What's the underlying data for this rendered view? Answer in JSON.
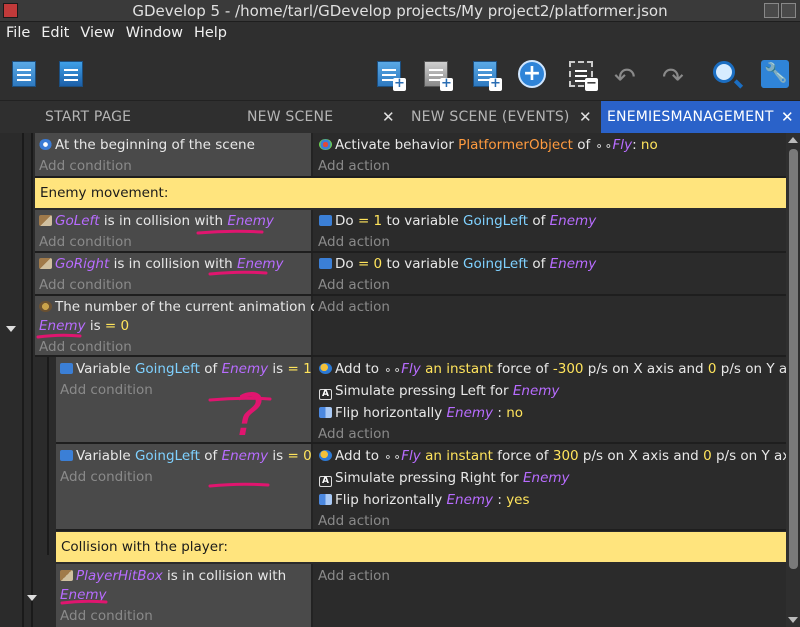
{
  "window": {
    "title": "GDevelop 5 - /home/tarl/GDevelop projects/My project2/platformer.json"
  },
  "menu": [
    "File",
    "Edit",
    "View",
    "Window",
    "Help"
  ],
  "toolbar": {
    "icons": [
      "project-manager-icon",
      "scene-icon",
      "add-event-icon",
      "add-subevent-icon",
      "add-event-alt-icon",
      "add-more-icon",
      "delete-event-icon",
      "undo-icon",
      "redo-icon",
      "search-icon",
      "settings-icon"
    ]
  },
  "tabs": [
    {
      "label": "START PAGE",
      "active": false
    },
    {
      "label": "NEW SCENE",
      "active": false
    },
    {
      "label": "NEW SCENE (EVENTS)",
      "active": false
    },
    {
      "label": "ENEMIESMANAGEMENT",
      "active": true
    }
  ],
  "close_glyph": "✕",
  "events": {
    "add_condition": "Add condition",
    "add_action": "Add action",
    "e1": {
      "cond": "At the beginning of the scene",
      "act_pre": "Activate behavior ",
      "act_beh": "PlatformerObject",
      "act_mid": " of ",
      "act_obj": "Fly",
      "act_post": ": ",
      "act_val": "no"
    },
    "comment1": "Enemy movement:",
    "e2": {
      "cond_obj": "GoLeft",
      "cond_mid": " is in collision with ",
      "cond_obj2": "Enemy",
      "act_pre": "Do ",
      "act_op": "= 1",
      "act_mid": " to variable ",
      "act_var": "GoingLeft",
      "act_of": " of ",
      "act_obj": "Enemy"
    },
    "e3": {
      "cond_obj": "GoRight",
      "cond_mid": " is in collision with ",
      "cond_obj2": "Enemy",
      "act_pre": "Do ",
      "act_op": "= 0",
      "act_mid": " to variable ",
      "act_var": "GoingLeft",
      "act_of": " of ",
      "act_obj": "Enemy"
    },
    "e4": {
      "cond_line1": "The number of the current animation of",
      "cond_obj": "Enemy",
      "cond_is": " is ",
      "cond_val": "= 0"
    },
    "e5": {
      "cond_pre": "Variable ",
      "cond_var": "GoingLeft",
      "cond_of": " of ",
      "cond_obj": "Enemy",
      "cond_is": " is ",
      "cond_val": "= 1",
      "a1_pre": "Add to ",
      "a1_obj": "Fly",
      "a1_kind": " an instant",
      "a1_mid": " force of ",
      "a1_x": "-300",
      "a1_mid2": " p/s on X axis and ",
      "a1_y": "0",
      "a1_post": " p/s on Y axis",
      "a2_pre": "Simulate pressing Left for ",
      "a2_obj": "Enemy",
      "a3_pre": "Flip horizontally ",
      "a3_obj": "Enemy",
      "a3_sep": " : ",
      "a3_val": "no"
    },
    "e6": {
      "cond_pre": "Variable ",
      "cond_var": "GoingLeft",
      "cond_of": " of ",
      "cond_obj": "Enemy",
      "cond_is": " is ",
      "cond_val": "= 0",
      "a1_pre": "Add to ",
      "a1_obj": "Fly",
      "a1_kind": " an instant",
      "a1_mid": " force of ",
      "a1_x": "300",
      "a1_mid2": " p/s on X axis and ",
      "a1_y": "0",
      "a1_post": " p/s on Y axis",
      "a2_pre": "Simulate pressing Right for ",
      "a2_obj": "Enemy",
      "a3_pre": "Flip horizontally ",
      "a3_obj": "Enemy",
      "a3_sep": " : ",
      "a3_val": "yes"
    },
    "comment2": "Collision with the player:",
    "e7": {
      "cond_obj": "PlayerHitBox",
      "cond_mid": " is in collision with",
      "cond_obj2": "Enemy"
    }
  },
  "colors": {
    "active_tab": "#2a62c9",
    "comment_bg": "#ffe47d",
    "object": "#b86cff",
    "variable": "#7fd1ff",
    "number": "#ffe45c",
    "behavior": "#ff9b3f",
    "annotation": "#e0156f"
  },
  "annotation_mark": "?"
}
